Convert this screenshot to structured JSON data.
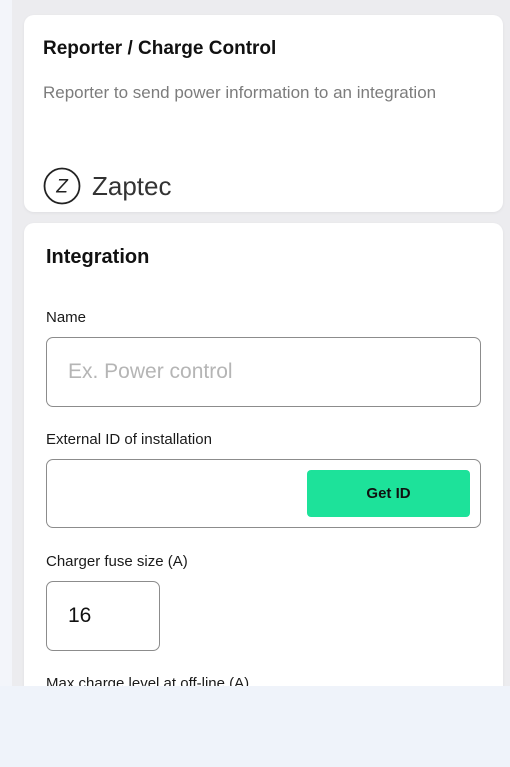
{
  "reporter_card": {
    "title": "Reporter / Charge Control",
    "description": "Reporter to send power information to an integration",
    "brand": {
      "name": "Zaptec",
      "logo_letter": "Z",
      "logo_icon": "zaptec-logo-icon"
    }
  },
  "integration_card": {
    "title": "Integration",
    "name_field": {
      "label": "Name",
      "value": "",
      "placeholder": "Ex. Power control"
    },
    "external_id_field": {
      "label": "External ID of installation",
      "value": "",
      "button_label": "Get ID"
    },
    "fuse_field": {
      "label": "Charger fuse size (A)",
      "value": "16"
    },
    "max_charge_field": {
      "label": "Max charge level at off-line (A)"
    }
  },
  "colors": {
    "accent_button": "#1de29a",
    "page_background": "#eff3fa",
    "card_background": "#ffffff",
    "muted_text": "#7c7c7c"
  }
}
